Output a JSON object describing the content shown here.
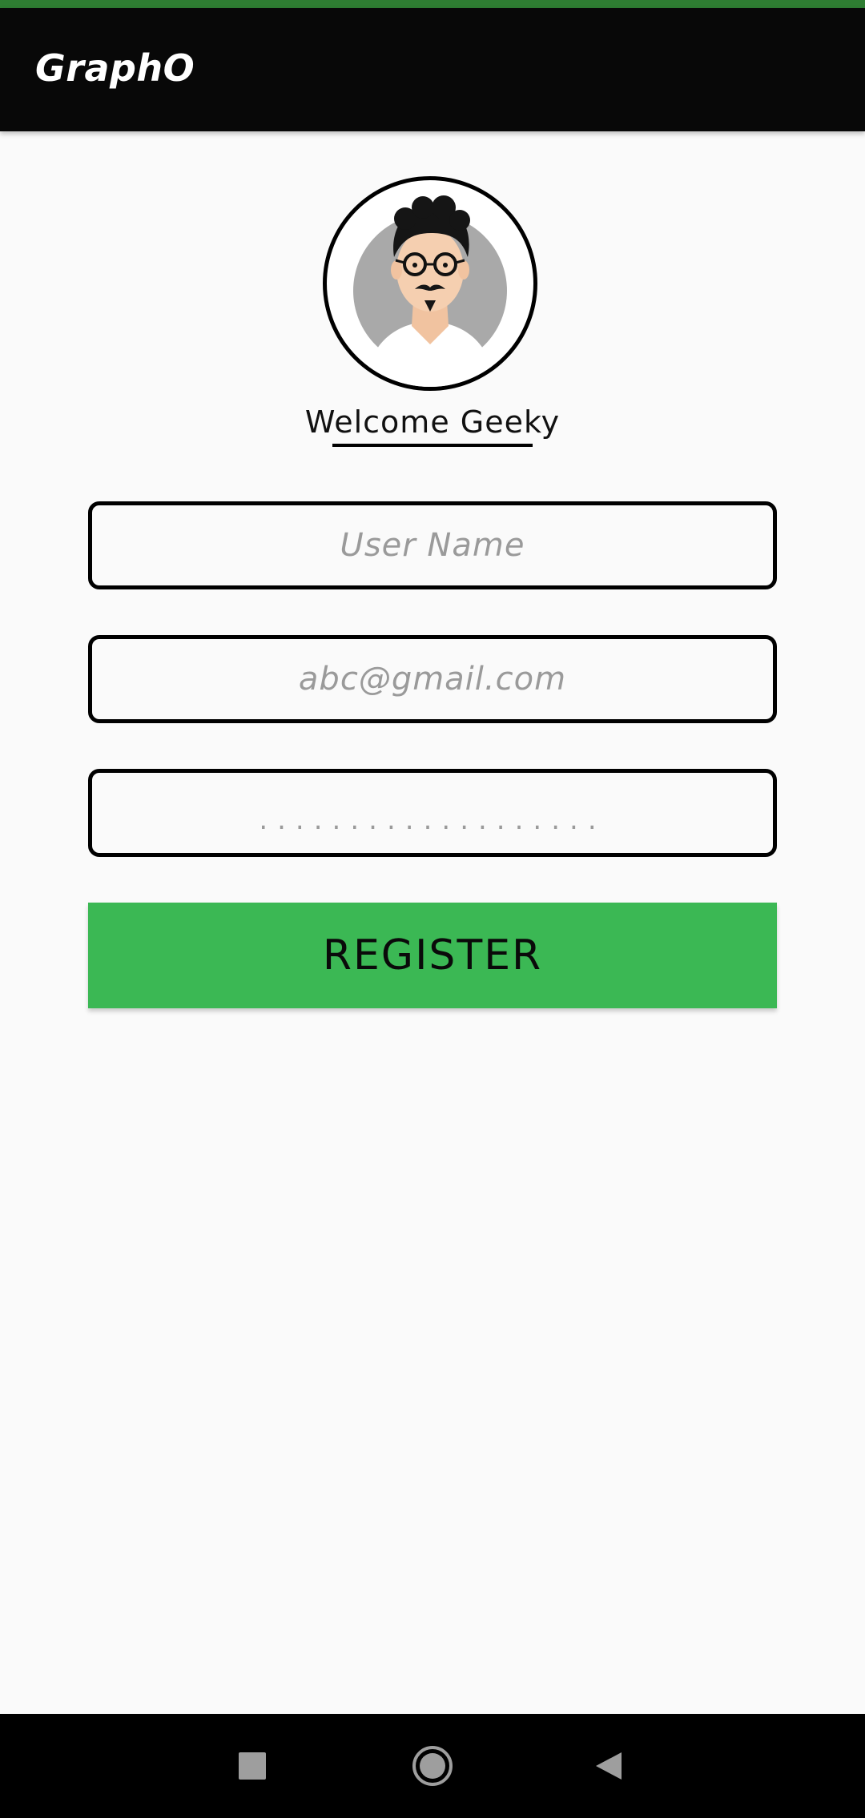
{
  "app_bar": {
    "title": "GraphO"
  },
  "profile": {
    "avatar_icon": "person-avatar-icon",
    "welcome_text": "Welcome Geeky"
  },
  "form": {
    "username_placeholder": "User Name",
    "email_placeholder": "abc@gmail.com",
    "password_mask": "...................",
    "register_label": "REGISTER"
  },
  "nav": {
    "recents_icon": "square-icon",
    "home_icon": "circle-icon",
    "back_icon": "triangle-back-icon"
  },
  "colors": {
    "status_strip": "#2e7d32",
    "app_bar": "#080808",
    "register_button": "#3bb854",
    "background": "#fafafa"
  }
}
